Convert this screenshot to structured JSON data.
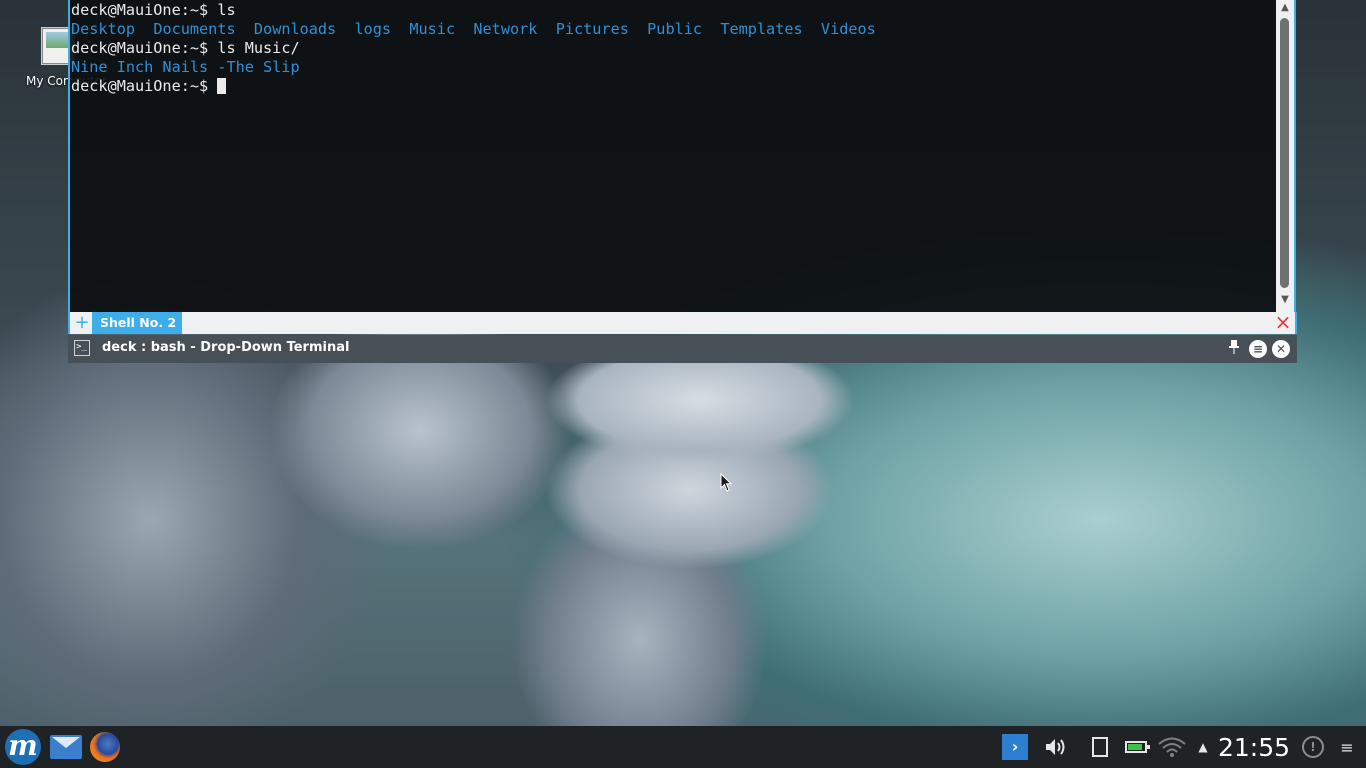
{
  "desktop": {
    "icon_label": "My Computer"
  },
  "terminal": {
    "lines": [
      {
        "prompt": "deck@MauiOne:~$ ",
        "command": "ls"
      },
      {
        "output": [
          "Desktop",
          "Documents",
          "Downloads",
          "logs",
          "Music",
          "Network",
          "Pictures",
          "Public",
          "Templates",
          "Videos"
        ]
      },
      {
        "prompt": "deck@MauiOne:~$ ",
        "command": "ls Music/"
      },
      {
        "output": [
          "Nine Inch Nails -The Slip"
        ]
      },
      {
        "prompt": "deck@MauiOne:~$ ",
        "command": ""
      }
    ],
    "tab_label": "Shell No. 2",
    "window_title": "deck : bash - Drop-Down Terminal",
    "output_color": "#2f8fd6",
    "accent_color": "#3daee9"
  },
  "taskbar": {
    "clock": "21:55",
    "icons": [
      "maui-launcher-icon",
      "mail-icon",
      "firefox-icon",
      "terminal-icon",
      "volume-icon",
      "clipboard-icon",
      "battery-icon",
      "wifi-icon",
      "expand-tray-icon",
      "notifications-icon",
      "menu-icon"
    ]
  }
}
